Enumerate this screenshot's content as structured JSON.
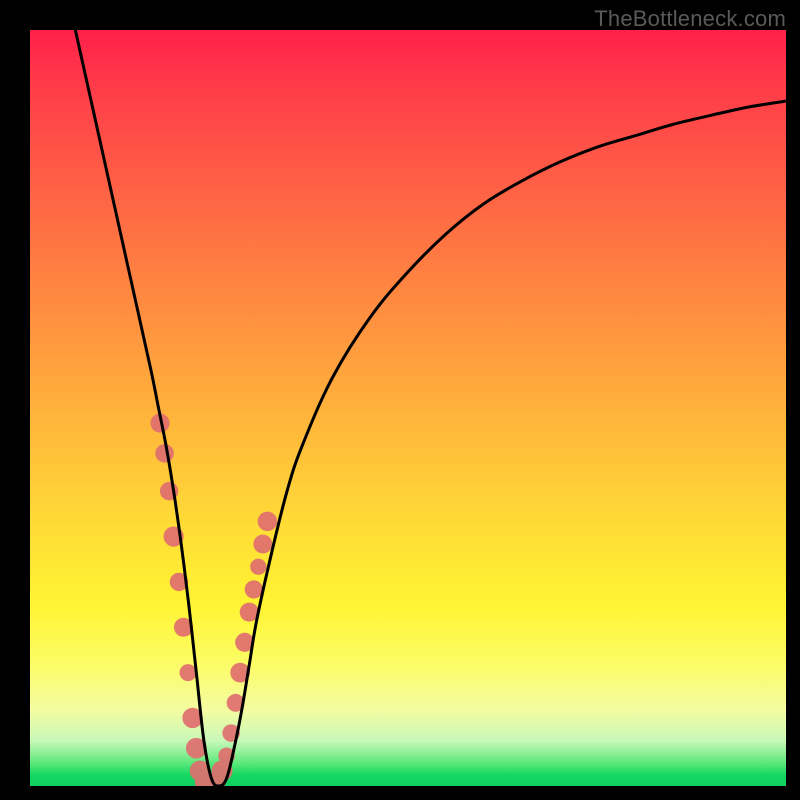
{
  "watermark": "TheBottleneck.com",
  "chart_data": {
    "type": "line",
    "title": "",
    "xlabel": "",
    "ylabel": "",
    "xlim": [
      0,
      100
    ],
    "ylim": [
      0,
      100
    ],
    "grid": false,
    "legend": false,
    "annotations": [],
    "series": [
      {
        "name": "curve",
        "color": "#000000",
        "x": [
          6,
          8,
          10,
          12,
          14,
          16,
          17,
          18,
          19,
          20,
          21,
          22,
          23,
          24,
          25,
          26,
          27,
          28,
          29,
          30,
          32,
          34,
          36,
          40,
          45,
          50,
          55,
          60,
          65,
          70,
          75,
          80,
          85,
          90,
          95,
          100
        ],
        "y": [
          100,
          91,
          82,
          73,
          64,
          55,
          50,
          45,
          39,
          32,
          24,
          15,
          6,
          1,
          0,
          1,
          5,
          10,
          16,
          22,
          31,
          39,
          45,
          54,
          62,
          68,
          73,
          77,
          80,
          82.5,
          84.5,
          86,
          87.5,
          88.7,
          89.8,
          90.6
        ]
      },
      {
        "name": "marker-cluster",
        "color": "#e57171",
        "type": "scatter",
        "x": [
          17.2,
          17.8,
          18.4,
          19.0,
          19.7,
          20.3,
          20.9,
          21.5,
          22.0,
          22.5,
          23.0,
          23.6,
          24.2,
          24.8,
          25.4,
          26.0,
          26.6,
          27.2,
          27.8,
          28.4,
          29.0,
          29.6,
          30.2,
          30.8,
          31.4
        ],
        "y": [
          48,
          44,
          39,
          33,
          27,
          21,
          15,
          9,
          5,
          2,
          0.5,
          0.2,
          0.3,
          0.8,
          2,
          4,
          7,
          11,
          15,
          19,
          23,
          26,
          29,
          32,
          35
        ]
      }
    ],
    "background_gradient_stops": [
      {
        "pos": 0.0,
        "color": "#ff1f4a"
      },
      {
        "pos": 0.3,
        "color": "#ff7a42"
      },
      {
        "pos": 0.66,
        "color": "#ffdd36"
      },
      {
        "pos": 0.9,
        "color": "#f3fca2"
      },
      {
        "pos": 0.98,
        "color": "#16d862"
      },
      {
        "pos": 1.0,
        "color": "#0fd160"
      }
    ]
  }
}
